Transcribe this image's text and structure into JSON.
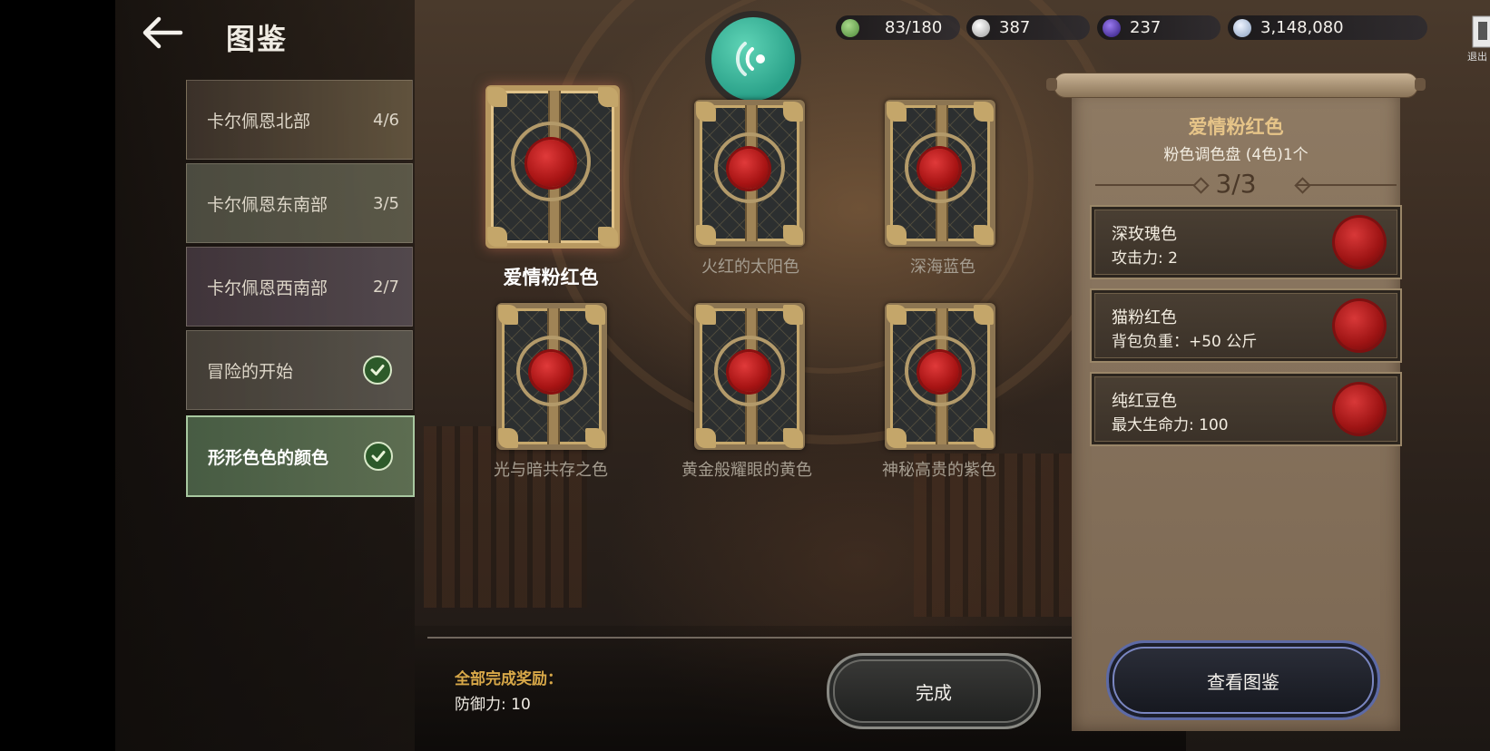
{
  "header": {
    "title": "图鉴",
    "exit_label": "退出"
  },
  "resources": [
    {
      "name": "stamina",
      "icon": "leaf-gem-icon",
      "color": "#6fae5a",
      "value": "83/180"
    },
    {
      "name": "silver-pearl",
      "icon": "silver-orb-icon",
      "color": "#d8d8d8",
      "value": "387"
    },
    {
      "name": "purple-gem",
      "icon": "purple-orb-icon",
      "color": "#6a3cc8",
      "value": "237"
    },
    {
      "name": "coins",
      "icon": "coin-stack-icon",
      "color": "#b8c8e0",
      "value": "3,148,080"
    }
  ],
  "sidebar": {
    "items": [
      {
        "label": "卡尔佩恩北部",
        "count": "4/6",
        "completed": false
      },
      {
        "label": "卡尔佩恩东南部",
        "count": "3/5",
        "completed": false
      },
      {
        "label": "卡尔佩恩西南部",
        "count": "2/7",
        "completed": false
      },
      {
        "label": "冒险的开始",
        "count": "",
        "completed": true
      },
      {
        "label": "形形色色的颜色",
        "count": "",
        "completed": true,
        "selected": true
      }
    ]
  },
  "cards": [
    {
      "name": "爱情粉红色",
      "selected": true
    },
    {
      "name": "火红的太阳色",
      "selected": false
    },
    {
      "name": "深海蓝色",
      "selected": false
    },
    {
      "name": "光与暗共存之色",
      "selected": false
    },
    {
      "name": "黄金般耀眼的黄色",
      "selected": false
    },
    {
      "name": "神秘高贵的紫色",
      "selected": false
    }
  ],
  "footer": {
    "reward_title": "全部完成奖励：",
    "reward_value": "防御力: 10",
    "done_label": "完成"
  },
  "detail": {
    "title": "爱情粉红色",
    "subtitle": "粉色调色盘 (4色)1个",
    "progress": "3/3",
    "entries": [
      {
        "name": "深玫瑰色",
        "stat": "攻击力: 2"
      },
      {
        "name": "猫粉红色",
        "stat": "背包负重：+50 公斤"
      },
      {
        "name": "纯红豆色",
        "stat": "最大生命力: 100"
      }
    ],
    "view_label": "查看图鉴"
  },
  "colors": {
    "accent_gold": "#d8a848",
    "seal_red": "#c82020",
    "scroll_bg": "#86725c"
  }
}
